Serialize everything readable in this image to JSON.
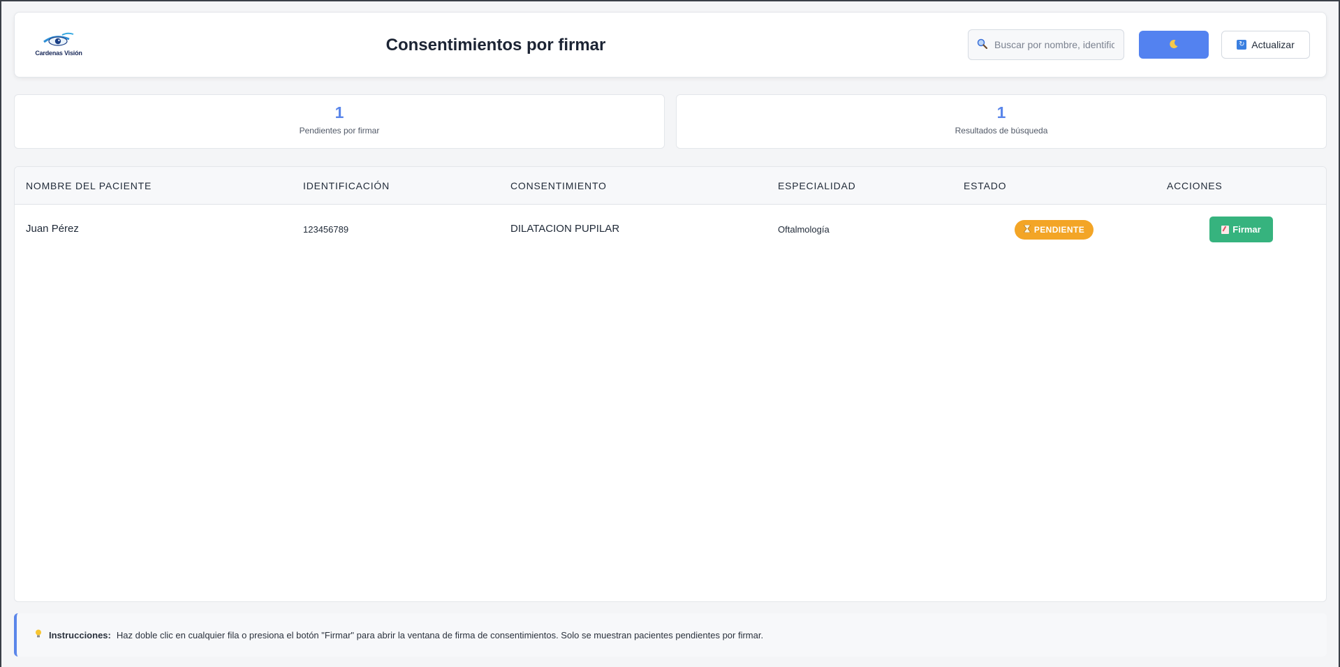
{
  "header": {
    "logo_text": "Cardenas Visión",
    "title": "Consentimientos por firmar",
    "search_placeholder": "Buscar por nombre, identificación",
    "theme_icon": "moon-icon",
    "refresh_label": "Actualizar",
    "refresh_icon": "refresh-icon"
  },
  "stats": [
    {
      "value": "1",
      "label": "Pendientes por firmar"
    },
    {
      "value": "1",
      "label": "Resultados de búsqueda"
    }
  ],
  "table": {
    "columns": [
      "Nombre del paciente",
      "Identificación",
      "Consentimiento",
      "Especialidad",
      "Estado",
      "Acciones"
    ],
    "rows": [
      {
        "name": "Juan Pérez",
        "id": "123456789",
        "consent": "DILATACION PUPILAR",
        "specialty": "Oftalmología",
        "status": "PENDIENTE",
        "action": "Firmar"
      }
    ]
  },
  "instructions": {
    "label": "Instrucciones:",
    "text": "Haz doble clic en cualquier fila o presiona el botón \"Firmar\" para abrir la ventana de firma de consentimientos. Solo se muestran pacientes pendientes por firmar."
  },
  "colors": {
    "accent": "#5382f0",
    "pending": "#f3a526",
    "sign": "#36b37e"
  }
}
